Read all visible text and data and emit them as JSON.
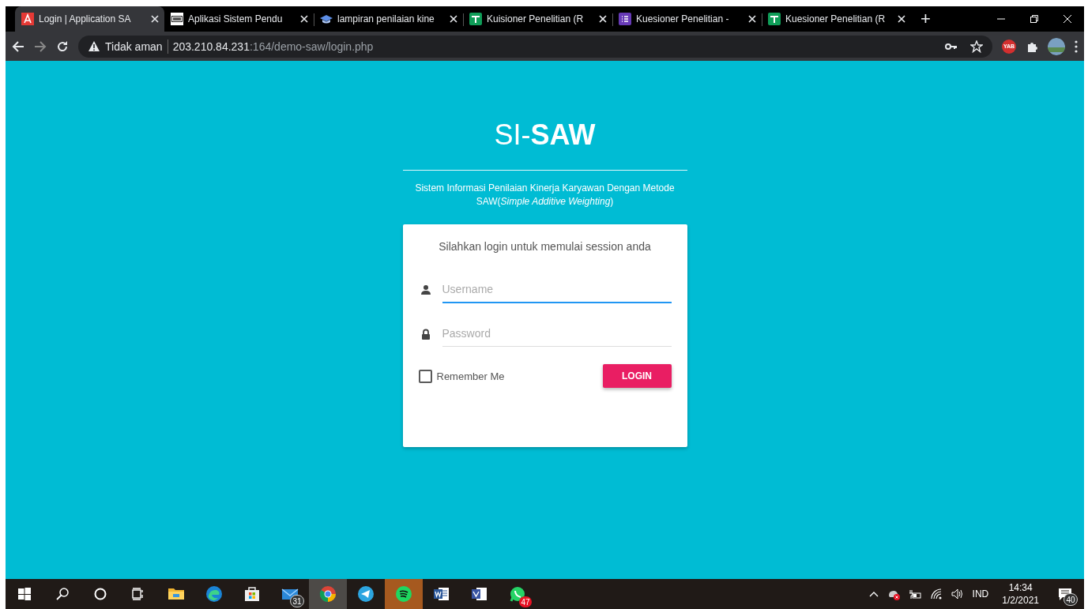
{
  "browser": {
    "tabs": [
      {
        "kind": "app-a",
        "title": "Login | Application SA",
        "selected": true
      },
      {
        "kind": "pkp",
        "title": "Aplikasi Sistem Pendu",
        "selected": false
      },
      {
        "kind": "cap",
        "title": "lampiran penilaian kine",
        "selected": false
      },
      {
        "kind": "sheet",
        "title": "Kuisioner Penelitian (R",
        "selected": false
      },
      {
        "kind": "form",
        "title": "Kuesioner Penelitian -",
        "selected": false
      },
      {
        "kind": "sheet",
        "title": "Kuesioner Penelitian (R",
        "selected": false
      }
    ],
    "new_tab": "+",
    "security": "Tidak aman",
    "url_host": "203.210.84.231",
    "url_path": ":164/demo-saw/login.php",
    "extension_badge": "YAB"
  },
  "page": {
    "title": "SI-**SAW**",
    "subtitle": "Sistem Informasi Penilaian Kinerja Karyawan Dengan Metode SAW(*Simple Additive Weighting*)",
    "card": {
      "heading": "Silahkan login untuk memulai session anda",
      "fields": [
        {
          "kind": "user",
          "placeholder": "Username",
          "focused": true
        },
        {
          "kind": "lock",
          "placeholder": "Password",
          "focused": false
        }
      ],
      "remember": {
        "label": "Remember Me",
        "checked": false
      },
      "button": "LOGIN"
    }
  },
  "taskbar": {
    "apps": [
      {
        "kind": "explorer",
        "active": false,
        "flashing": false
      },
      {
        "kind": "edge",
        "active": false,
        "flashing": false
      },
      {
        "kind": "store",
        "active": false,
        "flashing": false
      },
      {
        "kind": "mail",
        "badge": "31",
        "active": false,
        "flashing": false
      },
      {
        "kind": "chrome",
        "active": true,
        "flashing": false
      },
      {
        "kind": "telegram",
        "active": false,
        "flashing": false
      },
      {
        "kind": "spotify",
        "active": false,
        "flashing": true
      },
      {
        "kind": "word",
        "active": false,
        "flashing": false
      },
      {
        "kind": "visio",
        "active": false,
        "flashing": false
      },
      {
        "kind": "whatsapp",
        "badge": "47",
        "active": false,
        "flashing": false
      }
    ],
    "language": "IND",
    "time": "14:34",
    "date": "1/2/2021",
    "notifications": "40"
  }
}
